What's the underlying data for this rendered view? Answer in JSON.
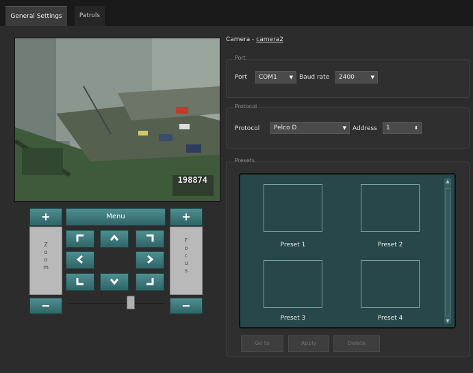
{
  "tabs": [
    {
      "label": "General Settings",
      "active": true
    },
    {
      "label": "Patrols",
      "active": false
    }
  ],
  "video": {
    "timestamp": "198874"
  },
  "ptz": {
    "menu_label": "Menu",
    "zoom_plus": "+",
    "zoom_minus": "−",
    "focus_plus": "+",
    "focus_minus": "−",
    "zoom_label": [
      "Z",
      "o",
      "o",
      "m"
    ],
    "focus_label": [
      "F",
      "o",
      "c",
      "u",
      "s"
    ]
  },
  "camera": {
    "prefix": "Camera - ",
    "name": "camera2"
  },
  "port_group": {
    "title": "Port",
    "port_label": "Port",
    "port_value": "COM1",
    "baud_label": "Baud rate",
    "baud_value": "2400"
  },
  "protocol_group": {
    "title": "Protocol",
    "protocol_label": "Protocol",
    "protocol_value": "Pelco D",
    "address_label": "Address",
    "address_value": "1"
  },
  "presets_group": {
    "title": "Presets",
    "items": [
      "Preset 1",
      "Preset 2",
      "Preset 3",
      "Preset 4"
    ]
  },
  "buttons": {
    "go_to": "Go to",
    "apply": "Apply",
    "delete": "Delete"
  },
  "colors": {
    "accent": "#3c7b7e",
    "presets_bg": "#27474a"
  }
}
